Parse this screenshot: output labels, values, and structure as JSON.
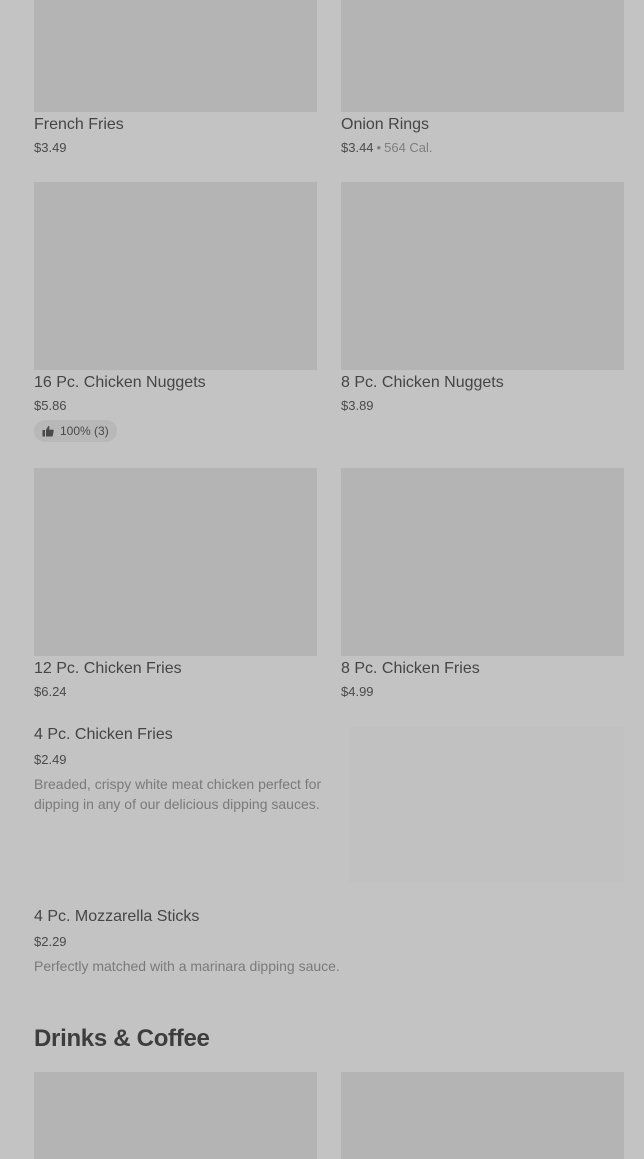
{
  "items_grid": [
    {
      "name": "French Fries",
      "price": "$3.49",
      "calories": ""
    },
    {
      "name": "Onion Rings",
      "price": "$3.44",
      "calories": "564 Cal."
    },
    {
      "name": "16 Pc. Chicken Nuggets",
      "price": "$5.86",
      "rating": "100% (3)"
    },
    {
      "name": "8 Pc. Chicken Nuggets",
      "price": "$3.89"
    },
    {
      "name": "12 Pc. Chicken Fries",
      "price": "$6.24"
    },
    {
      "name": "8 Pc. Chicken Fries",
      "price": "$4.99"
    }
  ],
  "items_list": [
    {
      "name": "4 Pc. Chicken Fries",
      "price": "$2.49",
      "description": "Breaded, crispy white meat chicken perfect for dipping in any of our delicious dipping sauces."
    },
    {
      "name": "4 Pc. Mozzarella Sticks",
      "price": "$2.29",
      "description": "Perfectly matched with a marinara dipping sauce."
    }
  ],
  "calorie_separator": "•",
  "section": {
    "title": "Drinks & Coffee"
  },
  "icons": {
    "rating": "thumbs-up-icon"
  },
  "colors": {
    "background": "#c3c3c3",
    "image_placeholder": "#b4b4b4"
  }
}
